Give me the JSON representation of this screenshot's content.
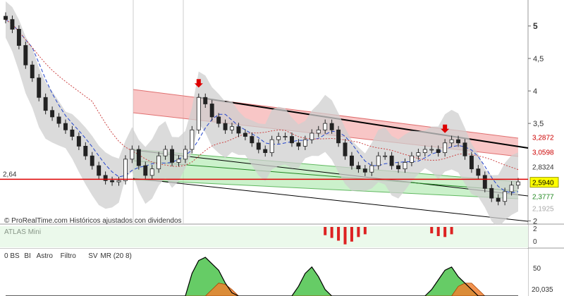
{
  "chart_data": {
    "type": "candlestick",
    "watermark": "© ProRealTime.com  Históricos ajustados con dividendos",
    "price_axis": {
      "ticks": [
        {
          "value": 5,
          "label": "5",
          "bold": true
        },
        {
          "value": 4.5,
          "label": "4,5",
          "bold": false
        },
        {
          "value": 4,
          "label": "4",
          "bold": false
        },
        {
          "value": 3.5,
          "label": "3,5",
          "bold": false
        },
        {
          "value": 2,
          "label": "2",
          "bold": false
        }
      ],
      "ylim": [
        1.95,
        5.4
      ]
    },
    "level_badges": [
      {
        "value": 3.2872,
        "label": "3,2872",
        "bg": "#ffffff",
        "fg": "#cc0000"
      },
      {
        "value": 3.0598,
        "label": "3,0598",
        "bg": "#ffffff",
        "fg": "#cc0000"
      },
      {
        "value": 2.8324,
        "label": "2,8324",
        "bg": "#ffffff",
        "fg": "#333333"
      },
      {
        "value": 2.594,
        "label": "2,5940",
        "bg": "#ffff00",
        "fg": "#000000"
      },
      {
        "value": 2.3777,
        "label": "2,3777",
        "bg": "#ffffff",
        "fg": "#228822"
      },
      {
        "value": 2.1925,
        "label": "2,1925",
        "bg": "#ffffff",
        "fg": "#aaaaaa"
      }
    ],
    "horizontal_line": {
      "value": 2.64,
      "label": "2,64",
      "color": "#dd0000"
    },
    "close_series": [
      5.1,
      4.95,
      4.7,
      4.4,
      4.2,
      3.9,
      3.7,
      3.6,
      3.5,
      3.4,
      3.3,
      3.15,
      3.0,
      2.85,
      2.7,
      2.62,
      2.6,
      2.62,
      2.95,
      3.1,
      2.85,
      2.7,
      2.8,
      3.0,
      3.1,
      2.9,
      2.95,
      3.1,
      3.4,
      3.9,
      3.8,
      3.6,
      3.5,
      3.4,
      3.45,
      3.35,
      3.3,
      3.2,
      3.1,
      3.05,
      3.25,
      3.3,
      3.3,
      3.2,
      3.15,
      3.25,
      3.35,
      3.4,
      3.5,
      3.4,
      3.2,
      3.0,
      2.85,
      2.8,
      2.75,
      2.85,
      3.0,
      3.0,
      2.85,
      2.8,
      2.9,
      3.0,
      3.05,
      3.1,
      3.1,
      3.05,
      3.2,
      3.25,
      3.2,
      3.0,
      2.8,
      2.7,
      2.5,
      2.35,
      2.3,
      2.45,
      2.55,
      2.6
    ],
    "signal_arrows": [
      {
        "index": 29,
        "color": "#dd0000"
      },
      {
        "index": 66,
        "color": "#dd0000"
      }
    ],
    "indicators": [
      {
        "title": "ATLAS Mini",
        "ylim": [
          -1,
          1
        ],
        "tick_labels": [
          "2",
          "0"
        ],
        "bars": [
          0,
          0,
          0,
          0,
          0,
          0,
          0,
          0,
          0,
          0,
          0,
          0,
          0,
          0,
          0,
          0,
          0,
          0,
          0,
          0,
          0,
          0,
          0,
          0,
          0,
          0,
          0,
          0,
          0,
          0,
          0,
          0,
          0,
          0,
          0,
          0,
          0,
          0,
          0,
          0,
          0,
          0,
          0,
          0,
          0,
          0,
          0,
          0,
          0.45,
          0.6,
          0.75,
          0.95,
          0.8,
          0.55,
          0.4,
          0,
          0,
          0,
          0,
          0,
          0,
          0,
          0,
          0,
          0.35,
          0.5,
          0.55,
          0.4,
          0,
          0,
          0,
          0,
          0,
          0,
          0,
          0,
          0,
          0
        ]
      },
      {
        "legend": [
          {
            "text": "0 BS",
            "color": "#666666"
          },
          {
            "text": "BI",
            "color": "#666666"
          },
          {
            "text": "Astro",
            "color": "#cc00cc"
          },
          {
            "text": "Filtro",
            "color": "#0000cc"
          },
          {
            "text": "SV",
            "color": "#555555"
          },
          {
            "text": "MR (20 8)",
            "color": "#cc0000"
          }
        ],
        "ylim": [
          0,
          70
        ],
        "tick_labels": [
          "50",
          "20,035"
        ],
        "green_hist": [
          0,
          0,
          0,
          0,
          0,
          0,
          0,
          0,
          0,
          0,
          0,
          0,
          0,
          0,
          0,
          0,
          0,
          0,
          0,
          0,
          0,
          0,
          0,
          0,
          0,
          0,
          0,
          0,
          35,
          55,
          60,
          50,
          40,
          20,
          5,
          0,
          0,
          0,
          0,
          0,
          0,
          0,
          0,
          0,
          15,
          35,
          45,
          30,
          10,
          0,
          0,
          0,
          0,
          0,
          0,
          0,
          0,
          0,
          0,
          0,
          0,
          0,
          0,
          0,
          10,
          25,
          40,
          45,
          30,
          20,
          10,
          0,
          0,
          0,
          0,
          0,
          0,
          0
        ],
        "orange_hist": [
          0,
          0,
          0,
          0,
          0,
          0,
          0,
          0,
          0,
          0,
          0,
          0,
          0,
          0,
          0,
          0,
          0,
          0,
          0,
          0,
          0,
          0,
          0,
          0,
          0,
          0,
          0,
          0,
          0,
          0,
          0,
          10,
          20,
          18,
          10,
          0,
          0,
          0,
          0,
          0,
          0,
          0,
          0,
          0,
          0,
          0,
          0,
          0,
          0,
          0,
          0,
          0,
          0,
          0,
          0,
          0,
          0,
          0,
          0,
          0,
          0,
          0,
          0,
          0,
          0,
          0,
          0,
          0,
          15,
          20,
          20,
          10,
          0,
          0,
          0,
          0,
          0,
          0
        ]
      }
    ]
  }
}
